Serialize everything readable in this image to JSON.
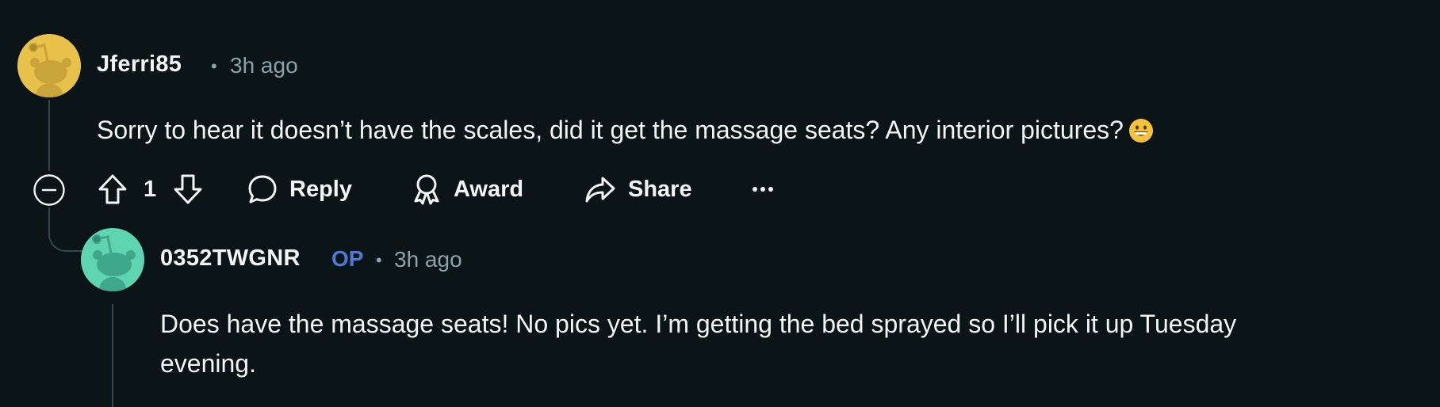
{
  "comments": [
    {
      "username": "Jferri85",
      "separator": "•",
      "time": "3h ago",
      "text": "Sorry to hear it doesn’t have the scales, did it get the massage seats? Any interior pictures?",
      "emoji_icon": "grinning-face-icon",
      "avatar_color": "#e7c14a",
      "actions": {
        "vote_count": "1",
        "reply_label": "Reply",
        "award_label": "Award",
        "share_label": "Share",
        "more_label": "•••"
      }
    },
    {
      "username": "0352TWGNR",
      "op_badge": "OP",
      "separator": "•",
      "time": "3h ago",
      "text_line1": "Does have the massage seats! No pics yet. I’m getting the bed sprayed so I’ll pick it up Tuesday",
      "text_line2": "evening.",
      "avatar_color": "#5ed4b0"
    }
  ],
  "colors": {
    "background": "#0b1416",
    "text": "#f2f4f5",
    "meta": "#8ba2ad",
    "op_blue": "#4d7ad6",
    "thread": "#33464c"
  }
}
